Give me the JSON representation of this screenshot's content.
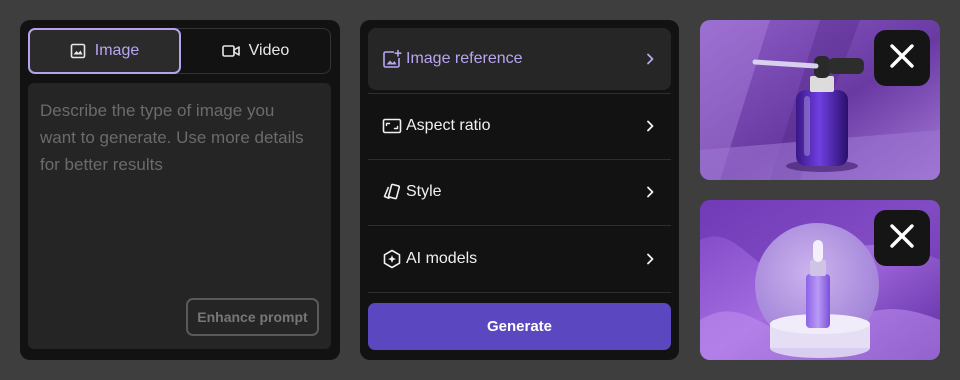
{
  "mode_tabs": [
    {
      "label": "Image",
      "active": true,
      "icon": "image-icon"
    },
    {
      "label": "Video",
      "active": false,
      "icon": "video-camera-icon"
    }
  ],
  "prompt": {
    "placeholder": "Describe the type of image you want to generate. Use more details for better results",
    "enhance_label": "Enhance prompt"
  },
  "options": [
    {
      "label": "Image reference",
      "icon": "image-add-icon",
      "active": true
    },
    {
      "label": "Aspect ratio",
      "icon": "aspect-ratio-icon",
      "active": false
    },
    {
      "label": "Style",
      "icon": "style-cards-icon",
      "active": false
    },
    {
      "label": "AI models",
      "icon": "ai-model-icon",
      "active": false
    }
  ],
  "generate_label": "Generate",
  "reference_images": [
    {
      "subject": "purple dropper bottle on purple background",
      "icon": "close-icon"
    },
    {
      "subject": "purple serum bottle on round pedestal with purple silk",
      "icon": "close-icon"
    }
  ],
  "colors": {
    "accent": "#b8a6f2",
    "generate": "#5b47c0",
    "page_bg": "#3e3e3e",
    "panel_bg": "#121212"
  }
}
